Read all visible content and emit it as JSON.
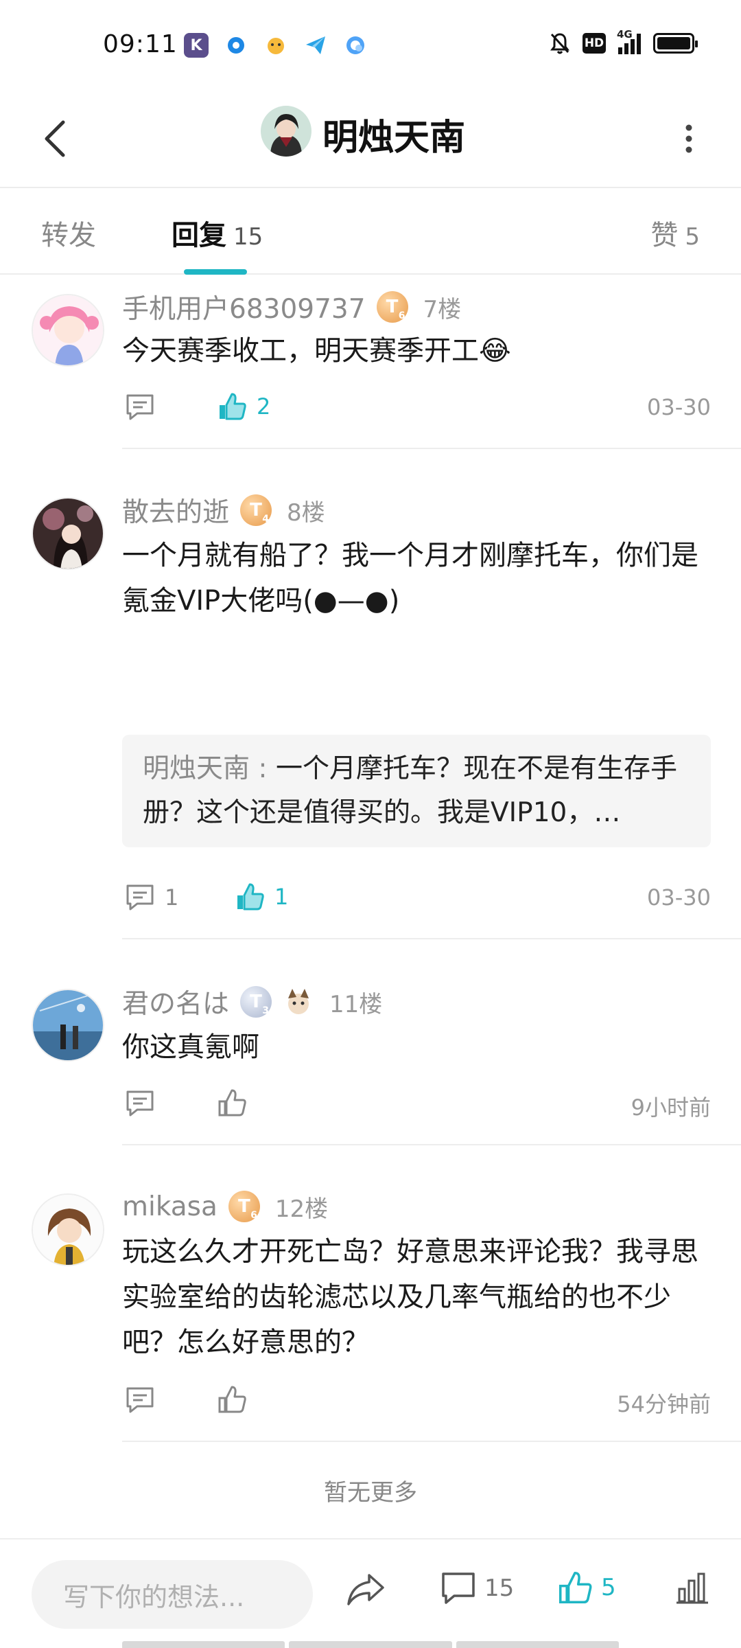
{
  "status_bar": {
    "time": "09:11",
    "network": "4G",
    "hd_label": "HD"
  },
  "header": {
    "title": "明烛天南"
  },
  "tabs": {
    "repost_label": "转发",
    "reply_label": "回复",
    "reply_count": "15",
    "like_label": "赞",
    "like_count": "5"
  },
  "comments": [
    {
      "user": "手机用户68309737",
      "badge": "T",
      "badge_level": "6",
      "floor": "7楼",
      "text": "今天赛季收工，明天赛季开工😂",
      "comment_count": "",
      "like_count": "2",
      "liked": true,
      "date": "03-30"
    },
    {
      "user": "散去的逝",
      "badge": "T",
      "badge_level": "4",
      "floor": "8楼",
      "text": "一个月就有船了？我一个月才刚摩托车，你们是氪金VIP大佬吗(●—●)",
      "quote_user": "明烛天南 :",
      "quote_text": " 一个月摩托车？现在不是有生存手册？这个还是值得买的。我是VIP10，…",
      "comment_count": "1",
      "like_count": "1",
      "liked": true,
      "date": "03-30"
    },
    {
      "user": "君の名は",
      "badge": "T",
      "badge_level": "3",
      "floor": "11楼",
      "text": "你这真氪啊",
      "comment_count": "",
      "like_count": "",
      "liked": false,
      "date": "9小时前"
    },
    {
      "user": "mikasa",
      "badge": "T",
      "badge_level": "6",
      "floor": "12楼",
      "text": "玩这么久才开死亡岛？好意思来评论我？我寻思实验室给的齿轮滤芯以及几率气瓶给的也不少吧？怎么好意思的？",
      "comment_count": "",
      "like_count": "",
      "liked": false,
      "date": "54分钟前"
    }
  ],
  "no_more_text": "暂无更多",
  "bottom_bar": {
    "input_placeholder": "写下你的想法...",
    "comment_count": "15",
    "like_count": "5"
  },
  "colors": {
    "accent": "#1fb6c4",
    "muted_text": "#8a8a8a",
    "divider": "#ededed"
  }
}
